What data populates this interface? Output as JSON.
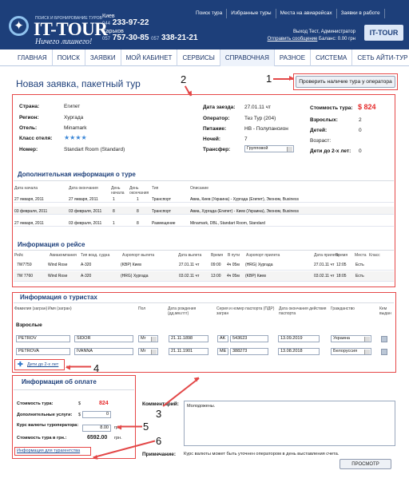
{
  "header": {
    "slogan_small": "ПОИСК И БРОНИРОВАНИЕ ТУРОВ",
    "logo": "IT-TOUR",
    "slogan": "Ничего лишнего!",
    "top_links": [
      "Поиск тура",
      "Избранные туры",
      "Места на авиарейсах",
      "Заявки в работе"
    ],
    "cities": [
      {
        "name": "Киев",
        "code": "044",
        "number": "233-97-22"
      },
      {
        "name": "Харьков",
        "code": "057",
        "number": "757-30-85",
        "code2": "057",
        "number2": "338-21-21"
      }
    ],
    "user_line1": "Выход   Тест, Администратор",
    "user_link": "Отправить сообщение",
    "balance": "Баланс: 0.00 грн",
    "logo_mini": "IT-TOUR"
  },
  "menu": [
    "ГЛАВНАЯ",
    "ПОИСК",
    "ЗАЯВКИ",
    "МОЙ КАБИНЕТ",
    "СЕРВИСЫ",
    "СПРАВОЧНАЯ",
    "РАЗНОЕ",
    "СИСТЕМА",
    "СЕТЬ АЙТИ-ТУР"
  ],
  "page": {
    "title": "Новая заявка, пакетный тур",
    "check_button": "Проверить наличие тура у оператора"
  },
  "tour": {
    "country_label": "Страна:",
    "country": "Египет",
    "region_label": "Регион:",
    "region": "Хургада",
    "hotel_label": "Отель:",
    "hotel": "Minamark",
    "class_label": "Класс отеля:",
    "class_stars": "★★★★",
    "room_label": "Номер:",
    "room": "Standart Room (Standard)",
    "date_label": "Дата заезда:",
    "date": "27.01.11 чт",
    "operator_label": "Оператор:",
    "operator": "Тез Тур (204)",
    "food_label": "Питание:",
    "food": "HB - Полупансион",
    "nights_label": "Ночей:",
    "nights": "7",
    "transfer_label": "Трансфер:",
    "transfer": "Групповой",
    "price_label": "Стоимость тура:",
    "price": "$ 824",
    "adults_label": "Взрослых:",
    "adults": "2",
    "children_label": "Детей:",
    "children": "0",
    "age_label": "Возраст:",
    "infants_label": "Дети до 2-х лет:",
    "infants": "0"
  },
  "extra": {
    "title": "Дополнительная информация о туре",
    "headers": [
      "Дата начала",
      "Дата окончания",
      "День начала",
      "День окончания",
      "Тип",
      "Описание"
    ],
    "rows": [
      [
        "27 января, 2011",
        "27 января, 2011",
        "1",
        "1",
        "Транспорт",
        "Авиа, Киев (Украина) - Хургада (Египет), Эконом, Business"
      ],
      [
        "03 февраля, 2011",
        "03 февраля, 2011",
        "8",
        "8",
        "Транспорт",
        "Авиа, Хургада (Египет) - Киев (Украина), Эконом, Business"
      ],
      [
        "27 января, 2011",
        "03 февраля, 2011",
        "1",
        "8",
        "Размещение",
        "Minamark, DBL, Standart Room, Standard"
      ]
    ]
  },
  "flight": {
    "title": "Информация о рейсе",
    "headers": [
      "Рейс",
      "Авиакомпания",
      "Тип возд. судна",
      "Аэропорт вылета",
      "Дата вылета",
      "Время",
      "В пути",
      "Аэропорт прилета",
      "Дата прилета",
      "Время",
      "Места",
      "Класс"
    ],
    "rows": [
      [
        "7W7759",
        "Wind Rose",
        "A-320",
        "(KBP) Киев",
        "27.01.11 чт",
        "09:00",
        "4ч 05м",
        "(HRG) Хургада",
        "27.01.11 чт",
        "12:05",
        "Есть",
        ""
      ],
      [
        "7W 7760",
        "Wind Rose",
        "A-320",
        "(HRG) Хургада",
        "03.02.11 чт",
        "13:00",
        "4ч 05м",
        "(KBP) Киев",
        "03.02.11 чт",
        "18:05",
        "Есть",
        ""
      ]
    ]
  },
  "tourists": {
    "title": "Информация о туристах",
    "headers": [
      "Фамилия (загран)",
      "Имя (загран)",
      "Пол",
      "Дата рождения (дд.мм.гггг)",
      "Серия и номер паспорта (ПДР) загран",
      "Дата окончания действия паспорта",
      "Гражданство",
      "Кем выдан"
    ],
    "group": "Взрослые",
    "rows": [
      [
        "PETROV",
        "SIDOR",
        "Mr",
        "21.11.1898",
        "AK",
        "543623",
        "13.09.2019",
        "Украина"
      ],
      [
        "PETROVA",
        "IVANNA",
        "Mr",
        "21.11.1901",
        "ME",
        "388273",
        "13.08.2018",
        "Белоруссия"
      ]
    ],
    "add_child": "Дети до 2-х лет"
  },
  "payment": {
    "title": "Информация об оплате",
    "price_label": "Стоимость тура:",
    "currency": "$",
    "price": "824",
    "extra_label": "Дополнительные услуги:",
    "extra_currency": "$",
    "extra": "0",
    "rate_label": "Курс валюты туроператора:",
    "rate": "8.00",
    "rate_unit": "грн.",
    "total_label": "Стоимость тура в грн.:",
    "total": "6592.00",
    "total_unit": "грн.",
    "agent_link": "Информация для турагентства"
  },
  "comments": {
    "label": "Комментарий:",
    "text": "Молодожены.",
    "note_label": "Примечание:",
    "note": "Курс валюты может быть уточнен оператором в день выставления счета.",
    "preview_button": "ПРОСМОТР"
  },
  "annotations": [
    "1",
    "2",
    "3",
    "4",
    "5",
    "6"
  ]
}
